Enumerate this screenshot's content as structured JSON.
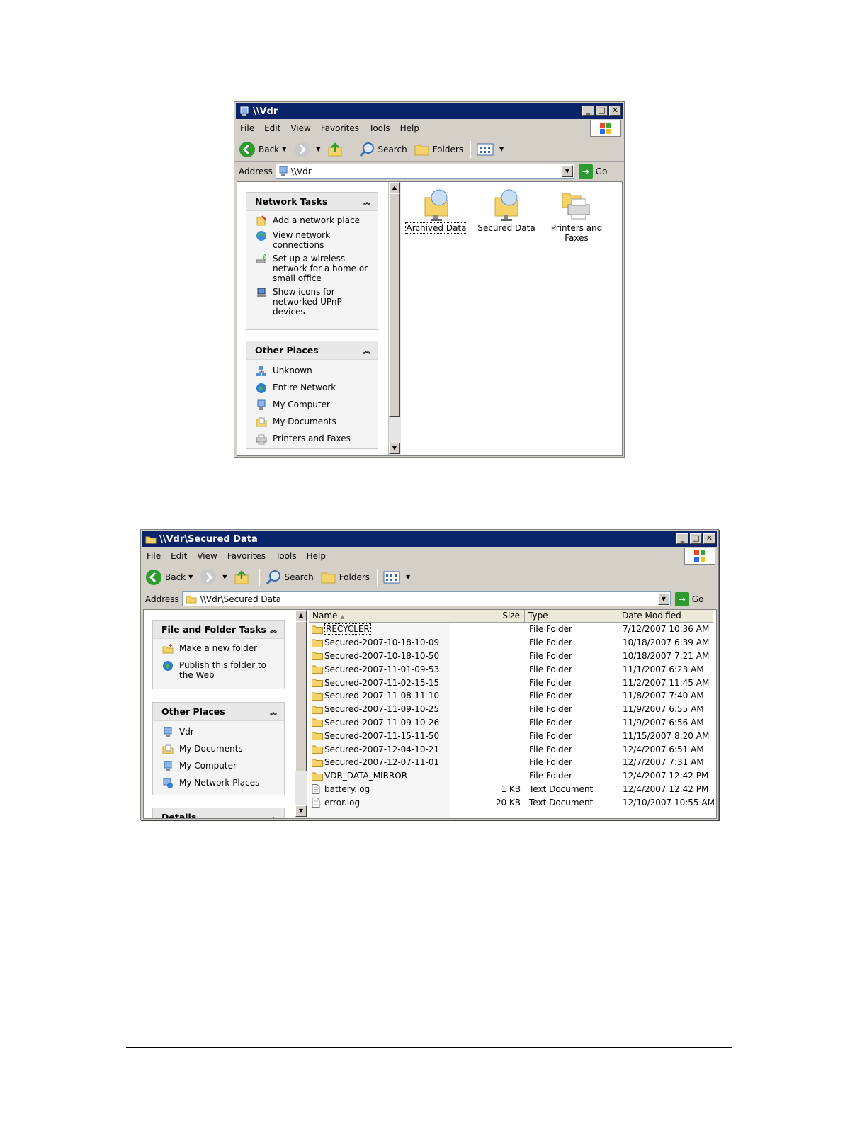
{
  "window1": {
    "title": "\\\\Vdr",
    "menu": [
      "File",
      "Edit",
      "View",
      "Favorites",
      "Tools",
      "Help"
    ],
    "toolbar": {
      "back": "Back",
      "search": "Search",
      "folders": "Folders"
    },
    "address_label": "Address",
    "address_value": "\\\\Vdr",
    "go_label": "Go",
    "network_tasks": {
      "header": "Network Tasks",
      "items": [
        "Add a network place",
        "View network connections",
        "Set up a wireless network for a home or small office",
        "Show icons for networked UPnP devices"
      ]
    },
    "other_places": {
      "header": "Other Places",
      "items": [
        "Unknown",
        "Entire Network",
        "My Computer",
        "My Documents",
        "Printers and Faxes"
      ]
    },
    "icons": [
      "Archived Data",
      "Secured Data",
      "Printers and Faxes"
    ]
  },
  "window2": {
    "title": "\\\\Vdr\\Secured Data",
    "menu": [
      "File",
      "Edit",
      "View",
      "Favorites",
      "Tools",
      "Help"
    ],
    "toolbar": {
      "back": "Back",
      "search": "Search",
      "folders": "Folders"
    },
    "address_label": "Address",
    "address_value": "\\\\Vdr\\Secured Data",
    "go_label": "Go",
    "file_tasks": {
      "header": "File and Folder Tasks",
      "items": [
        "Make a new folder",
        "Publish this folder to the Web"
      ]
    },
    "other_places": {
      "header": "Other Places",
      "items": [
        "Vdr",
        "My Documents",
        "My Computer",
        "My Network Places"
      ]
    },
    "details_header": "Details",
    "columns": [
      "Name",
      "Size",
      "Type",
      "Date Modified"
    ],
    "rows": [
      {
        "name": "RECYCLER",
        "size": "",
        "type": "File Folder",
        "date": "7/12/2007 10:36 AM",
        "kind": "folder"
      },
      {
        "name": "Secured-2007-10-18-10-09",
        "size": "",
        "type": "File Folder",
        "date": "10/18/2007 6:39 AM",
        "kind": "folder"
      },
      {
        "name": "Secured-2007-10-18-10-50",
        "size": "",
        "type": "File Folder",
        "date": "10/18/2007 7:21 AM",
        "kind": "folder"
      },
      {
        "name": "Secured-2007-11-01-09-53",
        "size": "",
        "type": "File Folder",
        "date": "11/1/2007 6:23 AM",
        "kind": "folder"
      },
      {
        "name": "Secured-2007-11-02-15-15",
        "size": "",
        "type": "File Folder",
        "date": "11/2/2007 11:45 AM",
        "kind": "folder"
      },
      {
        "name": "Secured-2007-11-08-11-10",
        "size": "",
        "type": "File Folder",
        "date": "11/8/2007 7:40 AM",
        "kind": "folder"
      },
      {
        "name": "Secured-2007-11-09-10-25",
        "size": "",
        "type": "File Folder",
        "date": "11/9/2007 6:55 AM",
        "kind": "folder"
      },
      {
        "name": "Secured-2007-11-09-10-26",
        "size": "",
        "type": "File Folder",
        "date": "11/9/2007 6:56 AM",
        "kind": "folder"
      },
      {
        "name": "Secured-2007-11-15-11-50",
        "size": "",
        "type": "File Folder",
        "date": "11/15/2007 8:20 AM",
        "kind": "folder"
      },
      {
        "name": "Secured-2007-12-04-10-21",
        "size": "",
        "type": "File Folder",
        "date": "12/4/2007 6:51 AM",
        "kind": "folder"
      },
      {
        "name": "Secured-2007-12-07-11-01",
        "size": "",
        "type": "File Folder",
        "date": "12/7/2007 7:31 AM",
        "kind": "folder"
      },
      {
        "name": "VDR_DATA_MIRROR",
        "size": "",
        "type": "File Folder",
        "date": "12/4/2007 12:42 PM",
        "kind": "folder"
      },
      {
        "name": "battery.log",
        "size": "1 KB",
        "type": "Text Document",
        "date": "12/4/2007 12:42 PM",
        "kind": "file"
      },
      {
        "name": "error.log",
        "size": "20 KB",
        "type": "Text Document",
        "date": "12/10/2007 10:55 AM",
        "kind": "file"
      }
    ]
  }
}
